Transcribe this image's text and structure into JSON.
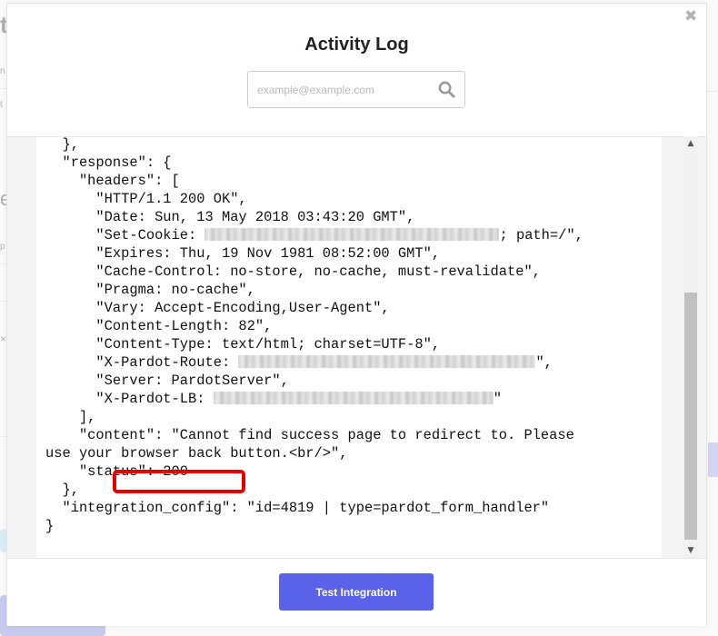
{
  "modal": {
    "title": "Activity Log",
    "close_glyph": "✖",
    "search": {
      "placeholder": "example@example.com",
      "value": "",
      "icon": "search-icon"
    },
    "footer": {
      "test_button_label": "Test Integration"
    }
  },
  "log": {
    "lines": [
      "  },",
      "  \"response\": {",
      "    \"headers\": [",
      "      \"HTTP/1.1 200 OK\",",
      "      \"Date: Sun, 13 May 2018 03:43:20 GMT\",",
      "      \"Set-Cookie: ",
      "; path=/\",",
      "      \"Expires: Thu, 19 Nov 1981 08:52:00 GMT\",",
      "      \"Cache-Control: no-store, no-cache, must-revalidate\",",
      "      \"Pragma: no-cache\",",
      "      \"Vary: Accept-Encoding,User-Agent\",",
      "      \"Content-Length: 82\",",
      "      \"Content-Type: text/html; charset=UTF-8\",",
      "      \"X-Pardot-Route: ",
      "\",",
      "      \"Server: PardotServer\",",
      "      \"X-Pardot-LB: ",
      "\"",
      "    ],",
      "    \"content\": \"Cannot find success page to redirect to. Please",
      "use your browser back button.<br/>\",",
      "    \"status\": 200",
      "  },",
      "  \"integration_config\": \"id=4819 | type=pardot_form_handler\"",
      "}"
    ]
  },
  "background": {
    "fragments": [
      "t",
      "n",
      "t",
      "e",
      "p",
      "×",
      "v"
    ]
  },
  "colors": {
    "accent": "#5b62ea",
    "highlight": "#e60000"
  }
}
